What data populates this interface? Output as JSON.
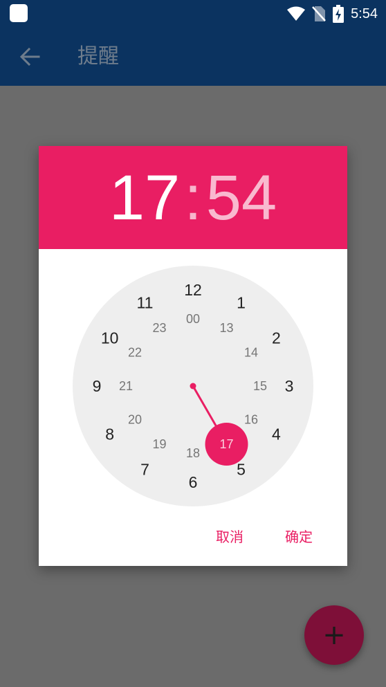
{
  "status_bar": {
    "time": "5:54",
    "icons": [
      "app-notification-icon",
      "wifi-icon",
      "no-sim-icon",
      "battery-charging-icon"
    ]
  },
  "app_bar": {
    "title": "提醒",
    "back_icon": "arrow-left-icon"
  },
  "dialog": {
    "hour": "17",
    "separator": ":",
    "minute": "54",
    "outer_hours": [
      "12",
      "1",
      "2",
      "3",
      "4",
      "5",
      "6",
      "7",
      "8",
      "9",
      "10",
      "11"
    ],
    "inner_hours": [
      "00",
      "13",
      "14",
      "15",
      "16",
      "17",
      "18",
      "19",
      "20",
      "21",
      "22",
      "23"
    ],
    "selected_hour": "17",
    "cancel_label": "取消",
    "ok_label": "确定",
    "accent_color": "#e91e63"
  },
  "fab": {
    "label": "+",
    "icon": "plus-icon"
  }
}
